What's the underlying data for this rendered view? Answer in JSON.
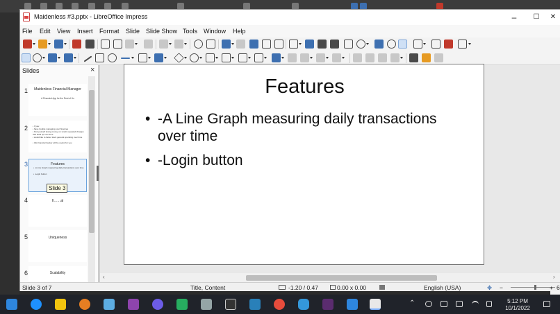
{
  "window": {
    "title": "Maidenless #3.pptx - LibreOffice Impress"
  },
  "window_controls": {
    "minimize": "–",
    "maximize": "☐",
    "close": "✕"
  },
  "menubar": [
    "File",
    "Edit",
    "View",
    "Insert",
    "Format",
    "Slide",
    "Slide Show",
    "Tools",
    "Window",
    "Help"
  ],
  "slides_panel": {
    "title": "Slides",
    "close": "×",
    "slides": [
      {
        "number": "1",
        "title": "Maidenless Financial Manager",
        "subtitle": "A Financial App for the Rest of Us"
      },
      {
        "number": "2",
        "bullets": [
          "• If you:",
          "• have trouble managing your finances",
          "• find yourself losing money on small, repeated charges that build up over time",
          "• would like to better track general spending over time",
          "• this financial tracker will be useful for you"
        ]
      },
      {
        "number": "3",
        "title": "Features",
        "bullets": [
          "• -A Line Graph measuring daily transactions over time",
          "• -Login button"
        ]
      },
      {
        "number": "4",
        "title": "Il……al"
      },
      {
        "number": "5",
        "title": "Uniqueness"
      },
      {
        "number": "6",
        "title": "Scalability"
      }
    ],
    "tooltip": "Slide 3"
  },
  "slide": {
    "title": "Features",
    "bullets": [
      "-A Line Graph measuring daily transactions over time",
      "-Login button"
    ],
    "bullet_glyph": "•"
  },
  "statusbar": {
    "slide_info": "Slide 3 of 7",
    "layout": "Title, Content",
    "position": "-1.20 / 0.47",
    "size": "0.00 x 0.00",
    "language": "English (USA)",
    "zoom_minus": "−",
    "zoom_plus": "+",
    "zoom_value": "6"
  },
  "taskbar": {
    "time": "5:12 PM",
    "date": "10/1/2022"
  },
  "colors": {
    "accent": "#3d6fb0",
    "selection": "#6aa3dd",
    "taskbar": "#20232a"
  }
}
